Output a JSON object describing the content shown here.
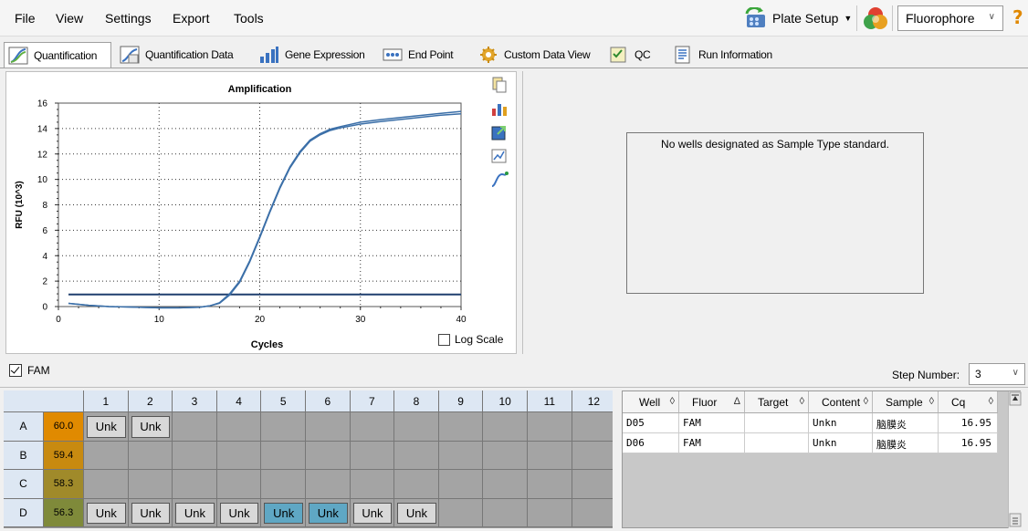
{
  "menu": {
    "file": "File",
    "view": "View",
    "settings": "Settings",
    "export": "Export",
    "tools": "Tools",
    "plate_setup": "Plate Setup",
    "fluorophore_value": "Fluorophore",
    "help": "?"
  },
  "tabs": [
    {
      "label": "Quantification"
    },
    {
      "label": "Quantification Data"
    },
    {
      "label": "Gene Expression"
    },
    {
      "label": "End Point"
    },
    {
      "label": "Custom Data View"
    },
    {
      "label": "QC"
    },
    {
      "label": "Run Information"
    }
  ],
  "chart": {
    "log_scale_label": "Log Scale",
    "log_scale_checked": false
  },
  "chart_data": {
    "type": "line",
    "title": "Amplification",
    "xlabel": "Cycles",
    "ylabel": "RFU (10^3)",
    "xlim": [
      0,
      40
    ],
    "ylim": [
      0,
      16
    ],
    "x_ticks": [
      "0",
      "10",
      "20",
      "30",
      "40"
    ],
    "y_ticks": [
      "0",
      "2",
      "4",
      "6",
      "8",
      "10",
      "12",
      "14",
      "16"
    ],
    "grid": true,
    "threshold": 0.95,
    "series": [
      {
        "x": [
          1,
          3,
          5,
          8,
          10,
          12,
          14,
          15,
          16,
          17,
          18,
          19,
          20,
          21,
          22,
          23,
          24,
          25,
          26,
          27,
          28,
          30,
          32,
          35,
          38,
          40
        ],
        "y": [
          0.25,
          0.1,
          0.0,
          -0.05,
          -0.1,
          -0.1,
          -0.05,
          0.05,
          0.25,
          0.9,
          1.9,
          3.5,
          5.4,
          7.4,
          9.3,
          10.9,
          12.1,
          13.0,
          13.5,
          13.85,
          14.05,
          14.35,
          14.55,
          14.8,
          15.05,
          15.15
        ]
      },
      {
        "x": [
          1,
          3,
          5,
          8,
          10,
          12,
          14,
          15,
          16,
          17,
          18,
          19,
          20,
          21,
          22,
          23,
          24,
          25,
          26,
          27,
          28,
          30,
          32,
          35,
          38,
          40
        ],
        "y": [
          0.25,
          0.1,
          0.0,
          -0.05,
          -0.1,
          -0.1,
          -0.05,
          0.05,
          0.3,
          1.0,
          2.0,
          3.6,
          5.5,
          7.5,
          9.4,
          11.0,
          12.2,
          13.1,
          13.6,
          13.95,
          14.15,
          14.5,
          14.7,
          14.95,
          15.2,
          15.35
        ]
      }
    ],
    "line_color": "#3b6fa8",
    "threshold_color": "#1f3f6e"
  },
  "std_curve": {
    "message": "No wells designated as Sample Type standard."
  },
  "fam": {
    "label": "FAM",
    "checked": true
  },
  "step": {
    "label": "Step Number:",
    "value": "3"
  },
  "plate": {
    "columns": [
      "1",
      "2",
      "3",
      "4",
      "5",
      "6",
      "7",
      "8",
      "9",
      "10",
      "11",
      "12"
    ],
    "rows": [
      {
        "label": "A",
        "temp": "60.0",
        "temp_color": "#e08a00"
      },
      {
        "label": "B",
        "temp": "59.4",
        "temp_color": "#c88a10"
      },
      {
        "label": "C",
        "temp": "58.3",
        "temp_color": "#a08a2a"
      },
      {
        "label": "D",
        "temp": "56.3",
        "temp_color": "#7f8a3a"
      }
    ],
    "unk_text": "Unk",
    "wells": [
      {
        "row": "A",
        "col": 1,
        "text": "Unk",
        "style": "plain"
      },
      {
        "row": "A",
        "col": 2,
        "text": "Unk",
        "style": "plain"
      },
      {
        "row": "D",
        "col": 1,
        "text": "Unk",
        "style": "plain"
      },
      {
        "row": "D",
        "col": 2,
        "text": "Unk",
        "style": "plain"
      },
      {
        "row": "D",
        "col": 3,
        "text": "Unk",
        "style": "plain"
      },
      {
        "row": "D",
        "col": 4,
        "text": "Unk",
        "style": "plain"
      },
      {
        "row": "D",
        "col": 5,
        "text": "Unk",
        "style": "blue"
      },
      {
        "row": "D",
        "col": 6,
        "text": "Unk",
        "style": "blue"
      },
      {
        "row": "D",
        "col": 7,
        "text": "Unk",
        "style": "plain"
      },
      {
        "row": "D",
        "col": 8,
        "text": "Unk",
        "style": "plain"
      }
    ]
  },
  "results": {
    "headers": [
      "Well",
      "Fluor",
      "Target",
      "Content",
      "Sample",
      "Cq"
    ],
    "sort_glyphs": [
      "◊",
      "Δ",
      "◊",
      "◊",
      "◊",
      "◊"
    ],
    "rows": [
      [
        "D05",
        "FAM",
        "",
        "Unkn",
        "脑膜炎",
        "16.95"
      ],
      [
        "D06",
        "FAM",
        "",
        "Unkn",
        "脑膜炎",
        "16.95"
      ]
    ]
  }
}
